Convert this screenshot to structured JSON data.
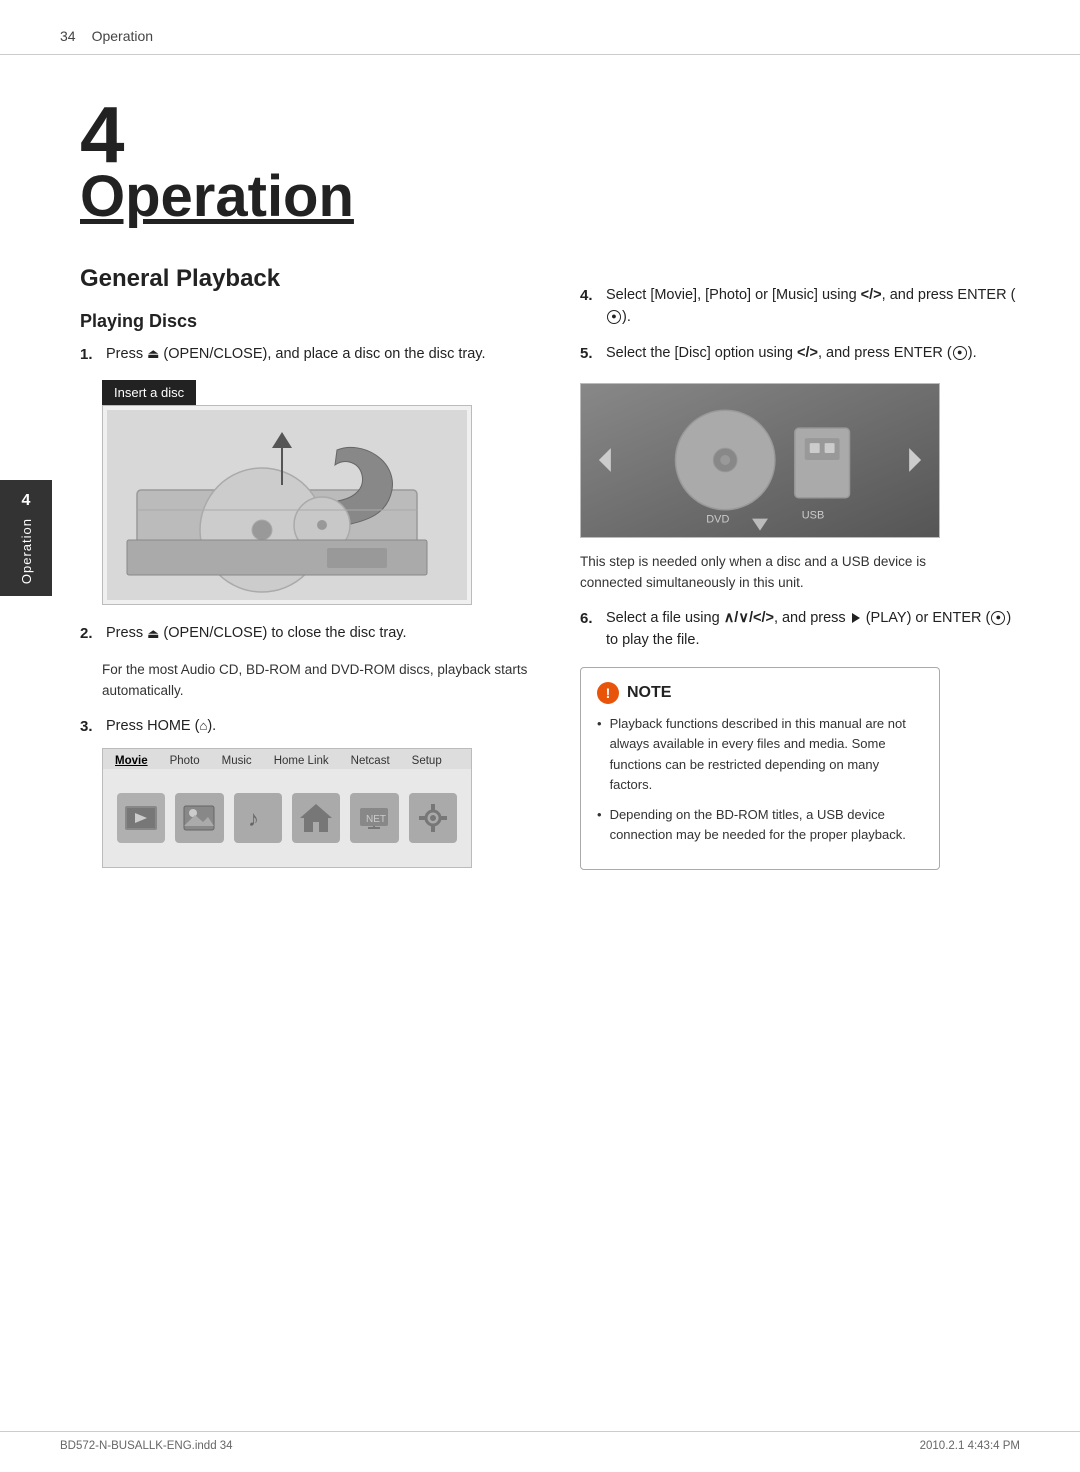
{
  "header": {
    "page_number": "34",
    "section_title": "Operation"
  },
  "chapter": {
    "number": "4",
    "title": "Operation"
  },
  "section": {
    "title": "General Playback",
    "subsection": "Playing Discs"
  },
  "steps_left": [
    {
      "num": "1.",
      "text": "Press",
      "eject": true,
      "text2": "(OPEN/CLOSE), and place a disc on the disc tray."
    },
    {
      "num": "2.",
      "text": "Press",
      "eject": true,
      "text2": "(OPEN/CLOSE) to close the disc tray."
    }
  ],
  "sub_text_2": "For the most Audio CD, BD-ROM and DVD-ROM discs, playback starts automatically.",
  "step3": {
    "num": "3.",
    "text": "Press HOME"
  },
  "insert_disc_label": "Insert a disc",
  "steps_right": [
    {
      "num": "4.",
      "text": "Select [Movie], [Photo] or [Music] using </>, and press ENTER"
    },
    {
      "num": "5.",
      "text": "Select the [Disc] option using </>, and press ENTER"
    }
  ],
  "dvd_usb_note": "This step is needed only when a disc and a USB device is connected simultaneously in this unit.",
  "step6": {
    "num": "6.",
    "text": "Select a file using ∧/∨/</>, and press",
    "text2": "(PLAY) or ENTER",
    "text3": "to play the file."
  },
  "note": {
    "title": "NOTE",
    "items": [
      "Playback functions described in this manual are not always available in every files and media. Some functions can be restricted depending on many factors.",
      "Depending on the BD-ROM titles, a USB device connection may be needed for the proper playback."
    ]
  },
  "side_tab": {
    "number": "4",
    "label": "Operation"
  },
  "home_menu": {
    "tabs": [
      "Movie",
      "Photo",
      "Music",
      "Home Link",
      "Netcast",
      "Setup"
    ]
  },
  "footer": {
    "left": "BD572-N-BUSALLK-ENG.indd  34",
    "right": "2010.2.1  4:43:4 PM"
  }
}
